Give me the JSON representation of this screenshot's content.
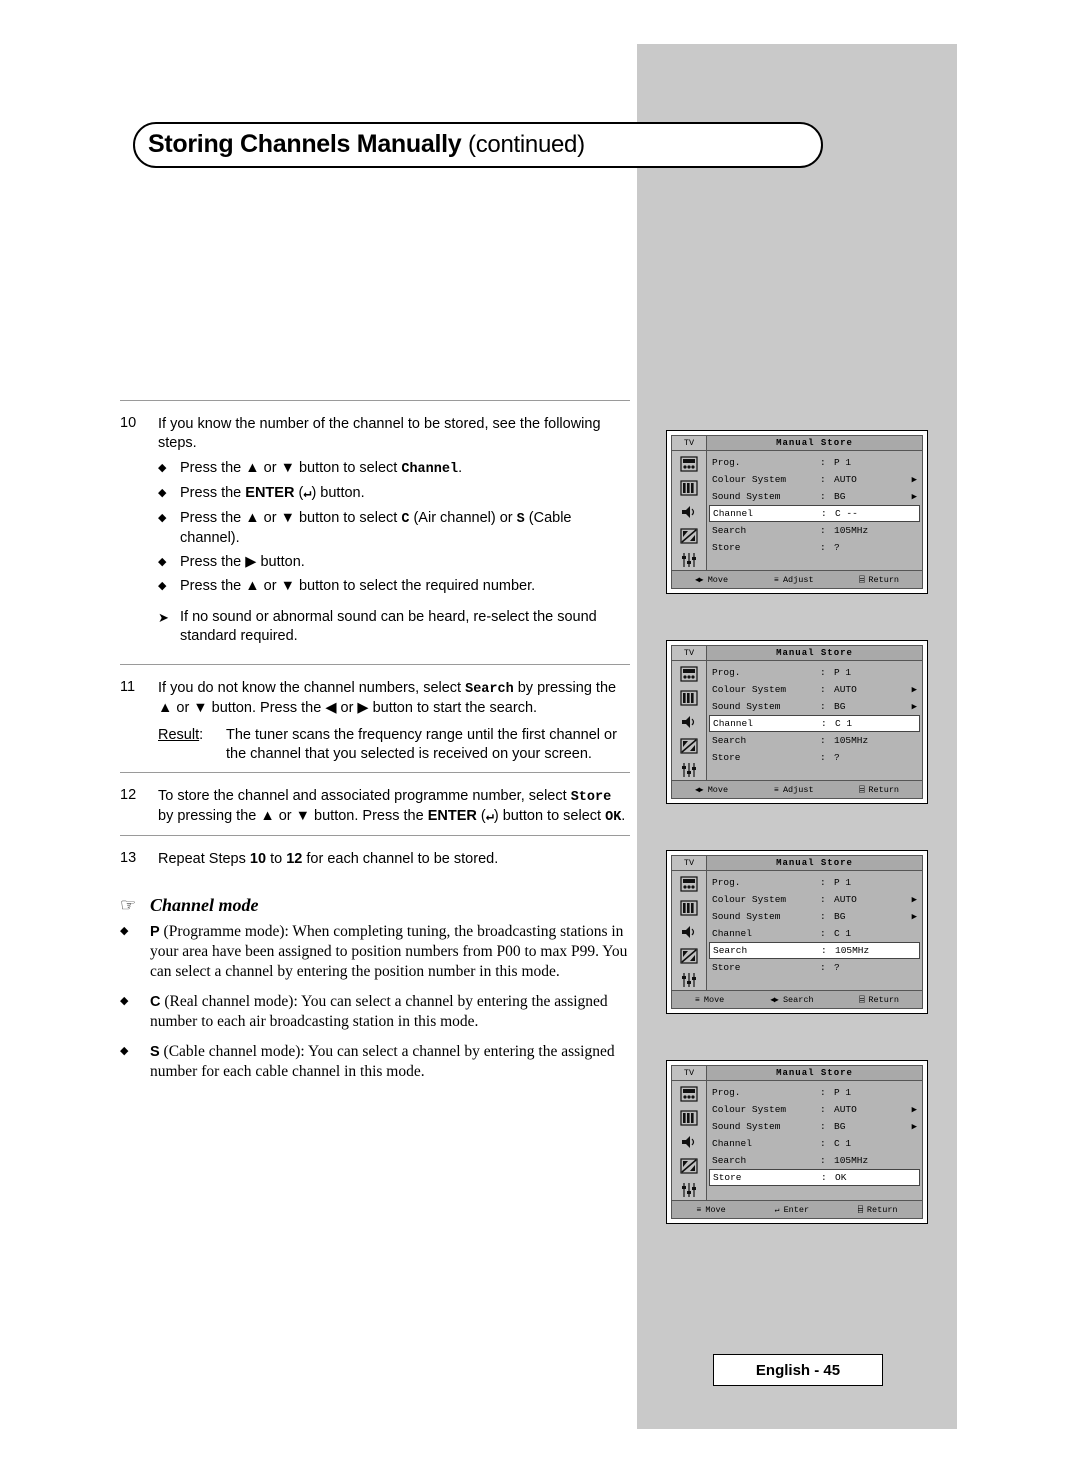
{
  "header": {
    "title_bold": "Storing Channels Manually",
    "title_cont": "(continued)"
  },
  "steps": [
    {
      "num": "10",
      "text": "If you know the number of the channel to be stored, see the following steps.",
      "bullets": [
        {
          "pre": "Press the ",
          "mid": "▲ or ▼",
          "post": " button to select ",
          "mono": "Channel",
          "tail": "."
        },
        {
          "pre": "Press the ",
          "bold": "ENTER",
          "post": " (",
          "key": "↵",
          "tail2": ")  button."
        },
        {
          "pre": "Press the ",
          "mid": "▲ or ▼",
          "post": " button to select ",
          "mono": "C",
          "tail": " (Air channel) or ",
          "mono2": "S",
          "tail3": " (Cable channel)."
        },
        {
          "pre": "Press the ",
          "mid": "▶",
          "post": " button.",
          "tail": ""
        },
        {
          "pre": "Press the ",
          "mid": "▲ or ▼",
          "post": " button to select the required number.",
          "tail": ""
        }
      ],
      "note": "If no sound or abnormal sound can be heard, re-select the sound standard required."
    },
    {
      "num": "11",
      "text_parts": {
        "p1": "If you do not know the channel numbers, select ",
        "mono": "Search",
        "p2": " by pressing the ▲ or ▼ button. Press the ◀ or ▶ button to start the search."
      },
      "result_label": "Result",
      "result_colon": ":",
      "result_text": "The tuner scans the frequency range until the first channel or the channel that you selected is received on your screen."
    },
    {
      "num": "12",
      "text_parts": {
        "p1": "To store the channel and associated programme number, select ",
        "mono": "Store",
        "p2": " by pressing the ▲ or ▼ button. Press the ",
        "bold": "ENTER",
        "p3": " (",
        "key": "↵",
        "p4": ") button to select ",
        "mono2": "OK",
        "p5": "."
      }
    },
    {
      "num": "13",
      "text_parts": {
        "p1": "Repeat Steps ",
        "b1": "10",
        "p2": " to ",
        "b2": "12",
        "p3": " for each channel to be stored."
      }
    }
  ],
  "channel_mode": {
    "hand_glyph": "☞",
    "title": "Channel mode",
    "items": [
      {
        "glyph": "◆",
        "lead": "P",
        "text": " (Programme mode): When completing tuning, the broadcasting stations in your area have been assigned to position numbers from P00 to max P99. You can select a channel by entering the position number in this mode."
      },
      {
        "glyph": "◆",
        "lead": "C",
        "text": " (Real channel mode): You can select a channel by entering the assigned number to each air broadcasting station in this mode."
      },
      {
        "glyph": "◆",
        "lead": "S",
        "text": " (Cable channel mode): You can select a channel by entering the assigned number for each cable channel in this mode."
      }
    ]
  },
  "osd_panels": [
    {
      "tv_label": "TV",
      "title": "Manual Store",
      "rows": [
        {
          "label": "Prog.",
          "colon": ":",
          "value": "P 1",
          "arrow": "",
          "selected": false
        },
        {
          "label": "Colour System",
          "colon": ":",
          "value": "AUTO",
          "arrow": "▶",
          "selected": false
        },
        {
          "label": "Sound System",
          "colon": ":",
          "value": "BG",
          "arrow": "▶",
          "selected": false
        },
        {
          "label": "Channel",
          "colon": ":",
          "value": "C --",
          "arrow": "",
          "selected": true
        },
        {
          "label": "Search",
          "colon": ":",
          "value": "105MHz",
          "arrow": "",
          "selected": false
        },
        {
          "label": "Store",
          "colon": ":",
          "value": "?",
          "arrow": "",
          "selected": false
        }
      ],
      "footer": [
        {
          "key": "◀▶",
          "label": "Move"
        },
        {
          "key": "≡",
          "label": "Adjust"
        },
        {
          "key": "⌸",
          "label": "Return"
        }
      ]
    },
    {
      "tv_label": "TV",
      "title": "Manual Store",
      "rows": [
        {
          "label": "Prog.",
          "colon": ":",
          "value": "P 1",
          "arrow": "",
          "selected": false
        },
        {
          "label": "Colour System",
          "colon": ":",
          "value": "AUTO",
          "arrow": "▶",
          "selected": false
        },
        {
          "label": "Sound System",
          "colon": ":",
          "value": "BG",
          "arrow": "▶",
          "selected": false
        },
        {
          "label": "Channel",
          "colon": ":",
          "value": "C 1",
          "arrow": "",
          "selected": true
        },
        {
          "label": "Search",
          "colon": ":",
          "value": "105MHz",
          "arrow": "",
          "selected": false
        },
        {
          "label": "Store",
          "colon": ":",
          "value": "?",
          "arrow": "",
          "selected": false
        }
      ],
      "footer": [
        {
          "key": "◀▶",
          "label": "Move"
        },
        {
          "key": "≡",
          "label": "Adjust"
        },
        {
          "key": "⌸",
          "label": "Return"
        }
      ]
    },
    {
      "tv_label": "TV",
      "title": "Manual Store",
      "rows": [
        {
          "label": "Prog.",
          "colon": ":",
          "value": "P 1",
          "arrow": "",
          "selected": false
        },
        {
          "label": "Colour System",
          "colon": ":",
          "value": "AUTO",
          "arrow": "▶",
          "selected": false
        },
        {
          "label": "Sound System",
          "colon": ":",
          "value": "BG",
          "arrow": "▶",
          "selected": false
        },
        {
          "label": "Channel",
          "colon": ":",
          "value": "C 1",
          "arrow": "",
          "selected": false
        },
        {
          "label": "Search",
          "colon": ":",
          "value": "105MHz",
          "arrow": "",
          "selected": true
        },
        {
          "label": "Store",
          "colon": ":",
          "value": "?",
          "arrow": "",
          "selected": false
        }
      ],
      "footer": [
        {
          "key": "≡",
          "label": "Move"
        },
        {
          "key": "◀▶",
          "label": "Search"
        },
        {
          "key": "⌸",
          "label": "Return"
        }
      ]
    },
    {
      "tv_label": "TV",
      "title": "Manual Store",
      "rows": [
        {
          "label": "Prog.",
          "colon": ":",
          "value": "P 1",
          "arrow": "",
          "selected": false
        },
        {
          "label": "Colour System",
          "colon": ":",
          "value": "AUTO",
          "arrow": "▶",
          "selected": false
        },
        {
          "label": "Sound System",
          "colon": ":",
          "value": "BG",
          "arrow": "▶",
          "selected": false
        },
        {
          "label": "Channel",
          "colon": ":",
          "value": "C 1",
          "arrow": "",
          "selected": false
        },
        {
          "label": "Search",
          "colon": ":",
          "value": "105MHz",
          "arrow": "",
          "selected": false
        },
        {
          "label": "Store",
          "colon": ":",
          "value": "OK",
          "arrow": "",
          "selected": true
        }
      ],
      "footer": [
        {
          "key": "≡",
          "label": "Move"
        },
        {
          "key": "↵",
          "label": "Enter"
        },
        {
          "key": "⌸",
          "label": "Return"
        }
      ]
    }
  ],
  "footer": {
    "text": "English - 45"
  }
}
